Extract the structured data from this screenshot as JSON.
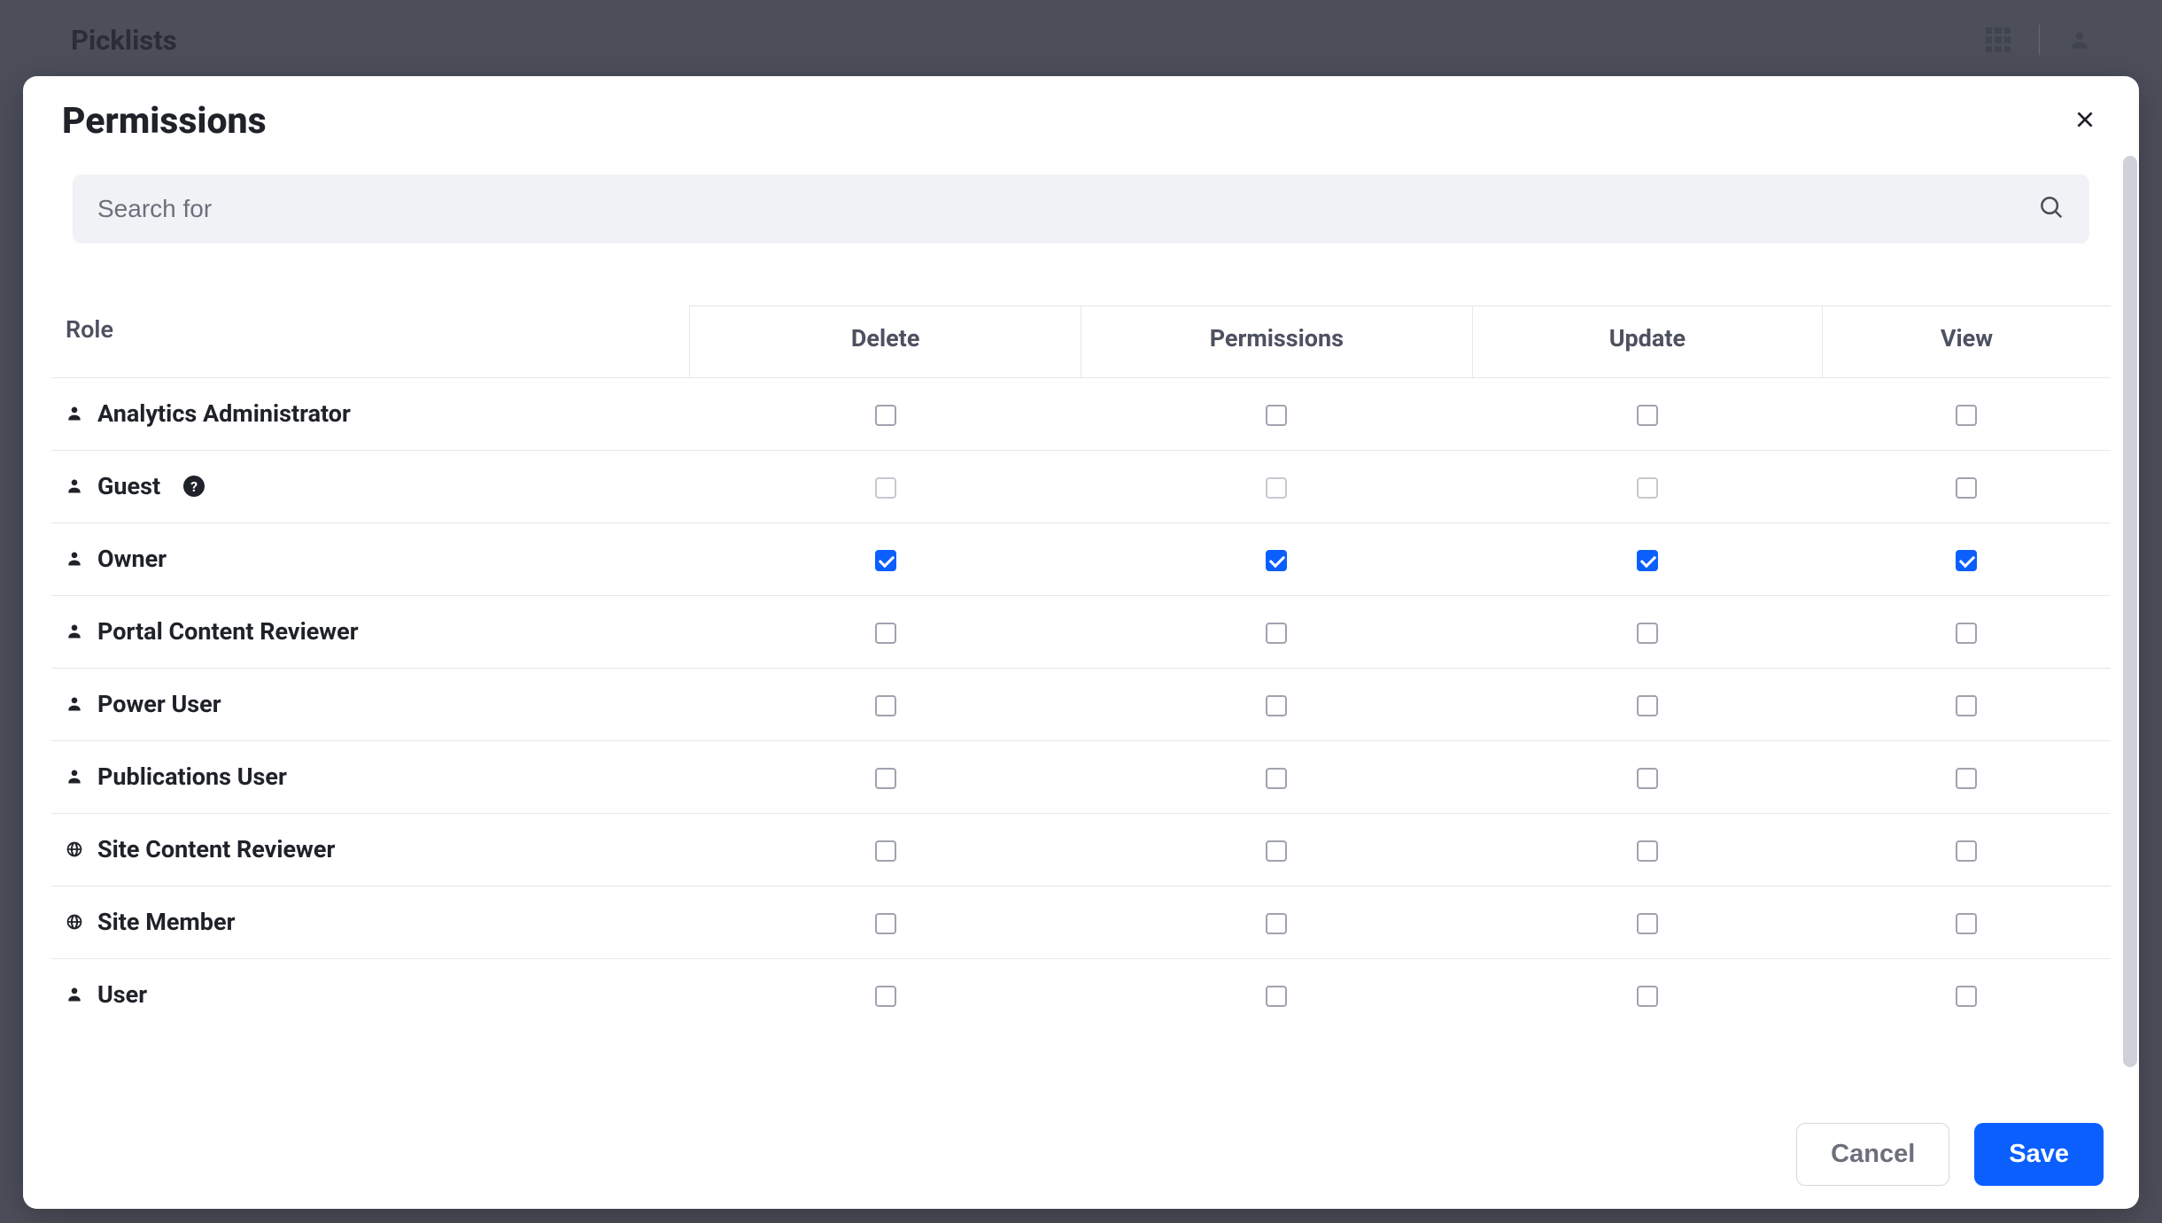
{
  "page": {
    "title": "Picklists"
  },
  "modal": {
    "title": "Permissions",
    "search_placeholder": "Search for",
    "columns": {
      "role": "Role",
      "delete": "Delete",
      "permissions": "Permissions",
      "update": "Update",
      "view": "View"
    },
    "rows": [
      {
        "icon": "user",
        "name": "Analytics Administrator",
        "info": false,
        "delete": {
          "checked": false,
          "disabled": false
        },
        "permissions": {
          "checked": false,
          "disabled": false
        },
        "update": {
          "checked": false,
          "disabled": false
        },
        "view": {
          "checked": false,
          "disabled": false
        }
      },
      {
        "icon": "user",
        "name": "Guest",
        "info": true,
        "delete": {
          "checked": false,
          "disabled": true
        },
        "permissions": {
          "checked": false,
          "disabled": true
        },
        "update": {
          "checked": false,
          "disabled": true
        },
        "view": {
          "checked": false,
          "disabled": false
        }
      },
      {
        "icon": "user",
        "name": "Owner",
        "info": false,
        "delete": {
          "checked": true,
          "disabled": false
        },
        "permissions": {
          "checked": true,
          "disabled": false
        },
        "update": {
          "checked": true,
          "disabled": false
        },
        "view": {
          "checked": true,
          "disabled": false
        }
      },
      {
        "icon": "user",
        "name": "Portal Content Reviewer",
        "info": false,
        "delete": {
          "checked": false,
          "disabled": false
        },
        "permissions": {
          "checked": false,
          "disabled": false
        },
        "update": {
          "checked": false,
          "disabled": false
        },
        "view": {
          "checked": false,
          "disabled": false
        }
      },
      {
        "icon": "user",
        "name": "Power User",
        "info": false,
        "delete": {
          "checked": false,
          "disabled": false
        },
        "permissions": {
          "checked": false,
          "disabled": false
        },
        "update": {
          "checked": false,
          "disabled": false
        },
        "view": {
          "checked": false,
          "disabled": false
        }
      },
      {
        "icon": "user",
        "name": "Publications User",
        "info": false,
        "delete": {
          "checked": false,
          "disabled": false
        },
        "permissions": {
          "checked": false,
          "disabled": false
        },
        "update": {
          "checked": false,
          "disabled": false
        },
        "view": {
          "checked": false,
          "disabled": false
        }
      },
      {
        "icon": "globe",
        "name": "Site Content Reviewer",
        "info": false,
        "delete": {
          "checked": false,
          "disabled": false
        },
        "permissions": {
          "checked": false,
          "disabled": false
        },
        "update": {
          "checked": false,
          "disabled": false
        },
        "view": {
          "checked": false,
          "disabled": false
        }
      },
      {
        "icon": "globe",
        "name": "Site Member",
        "info": false,
        "delete": {
          "checked": false,
          "disabled": false
        },
        "permissions": {
          "checked": false,
          "disabled": false
        },
        "update": {
          "checked": false,
          "disabled": false
        },
        "view": {
          "checked": false,
          "disabled": false
        }
      },
      {
        "icon": "user",
        "name": "User",
        "info": false,
        "delete": {
          "checked": false,
          "disabled": false
        },
        "permissions": {
          "checked": false,
          "disabled": false
        },
        "update": {
          "checked": false,
          "disabled": false
        },
        "view": {
          "checked": false,
          "disabled": false
        }
      }
    ],
    "buttons": {
      "cancel": "Cancel",
      "save": "Save"
    },
    "info_symbol": "?"
  }
}
